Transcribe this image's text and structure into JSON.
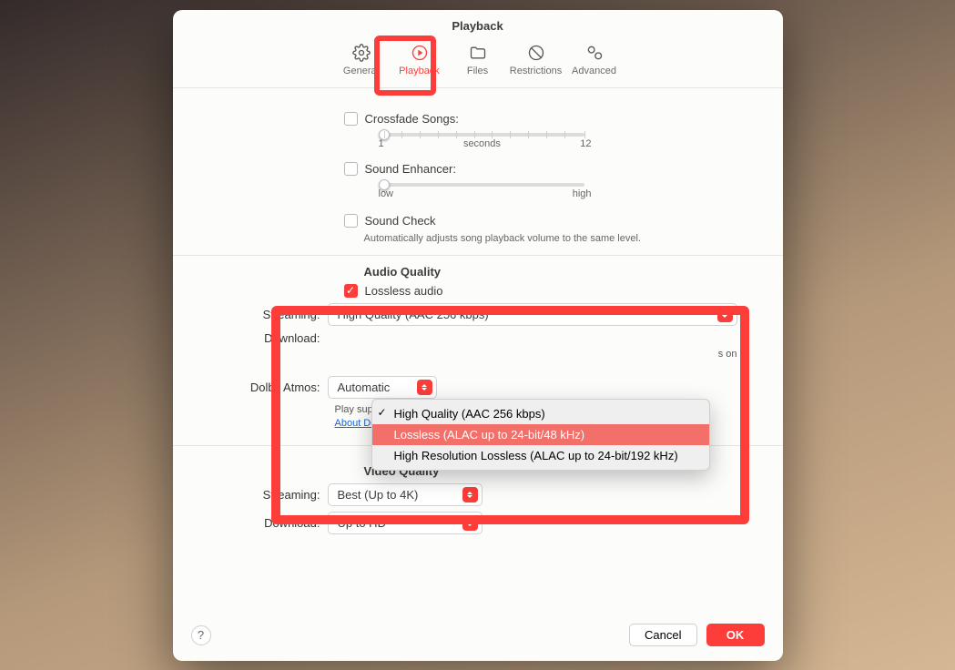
{
  "title": "Playback",
  "tabs": {
    "general": "General",
    "playback": "Playback",
    "files": "Files",
    "restrictions": "Restrictions",
    "advanced": "Advanced"
  },
  "crossfade": {
    "label": "Crossfade Songs:",
    "min": "1",
    "mid": "seconds",
    "max": "12"
  },
  "enhancer": {
    "label": "Sound Enhancer:",
    "low": "low",
    "high": "high"
  },
  "soundcheck": {
    "label": "Sound Check",
    "desc": "Automatically adjusts song playback volume to the same level."
  },
  "audio_quality": {
    "heading": "Audio Quality",
    "lossless_label": "Lossless audio",
    "streaming_label": "Streaming:",
    "streaming_value": "High Quality (AAC 256 kbps)",
    "download_label": "Download:",
    "options": {
      "o1": "High Quality (AAC 256 kbps)",
      "o2": "Lossless (ALAC up to 24-bit/48 kHz)",
      "o3": "High Resolution Lossless (ALAC up to 24-bit/192 kHz)"
    },
    "note_tail": "s on",
    "dolby_label": "Dolby Atmos:",
    "dolby_value": "Automatic",
    "dolby_desc": "Play supported songs in Dolby Atmos and other Dolby Audio formats.",
    "dolby_link": "About Dolby Atmos."
  },
  "video_quality": {
    "heading": "Video Quality",
    "streaming_label": "Streaming:",
    "streaming_value": "Best (Up to 4K)",
    "download_label": "Download:",
    "download_value": "Up to HD"
  },
  "footer": {
    "help": "?",
    "cancel": "Cancel",
    "ok": "OK"
  }
}
